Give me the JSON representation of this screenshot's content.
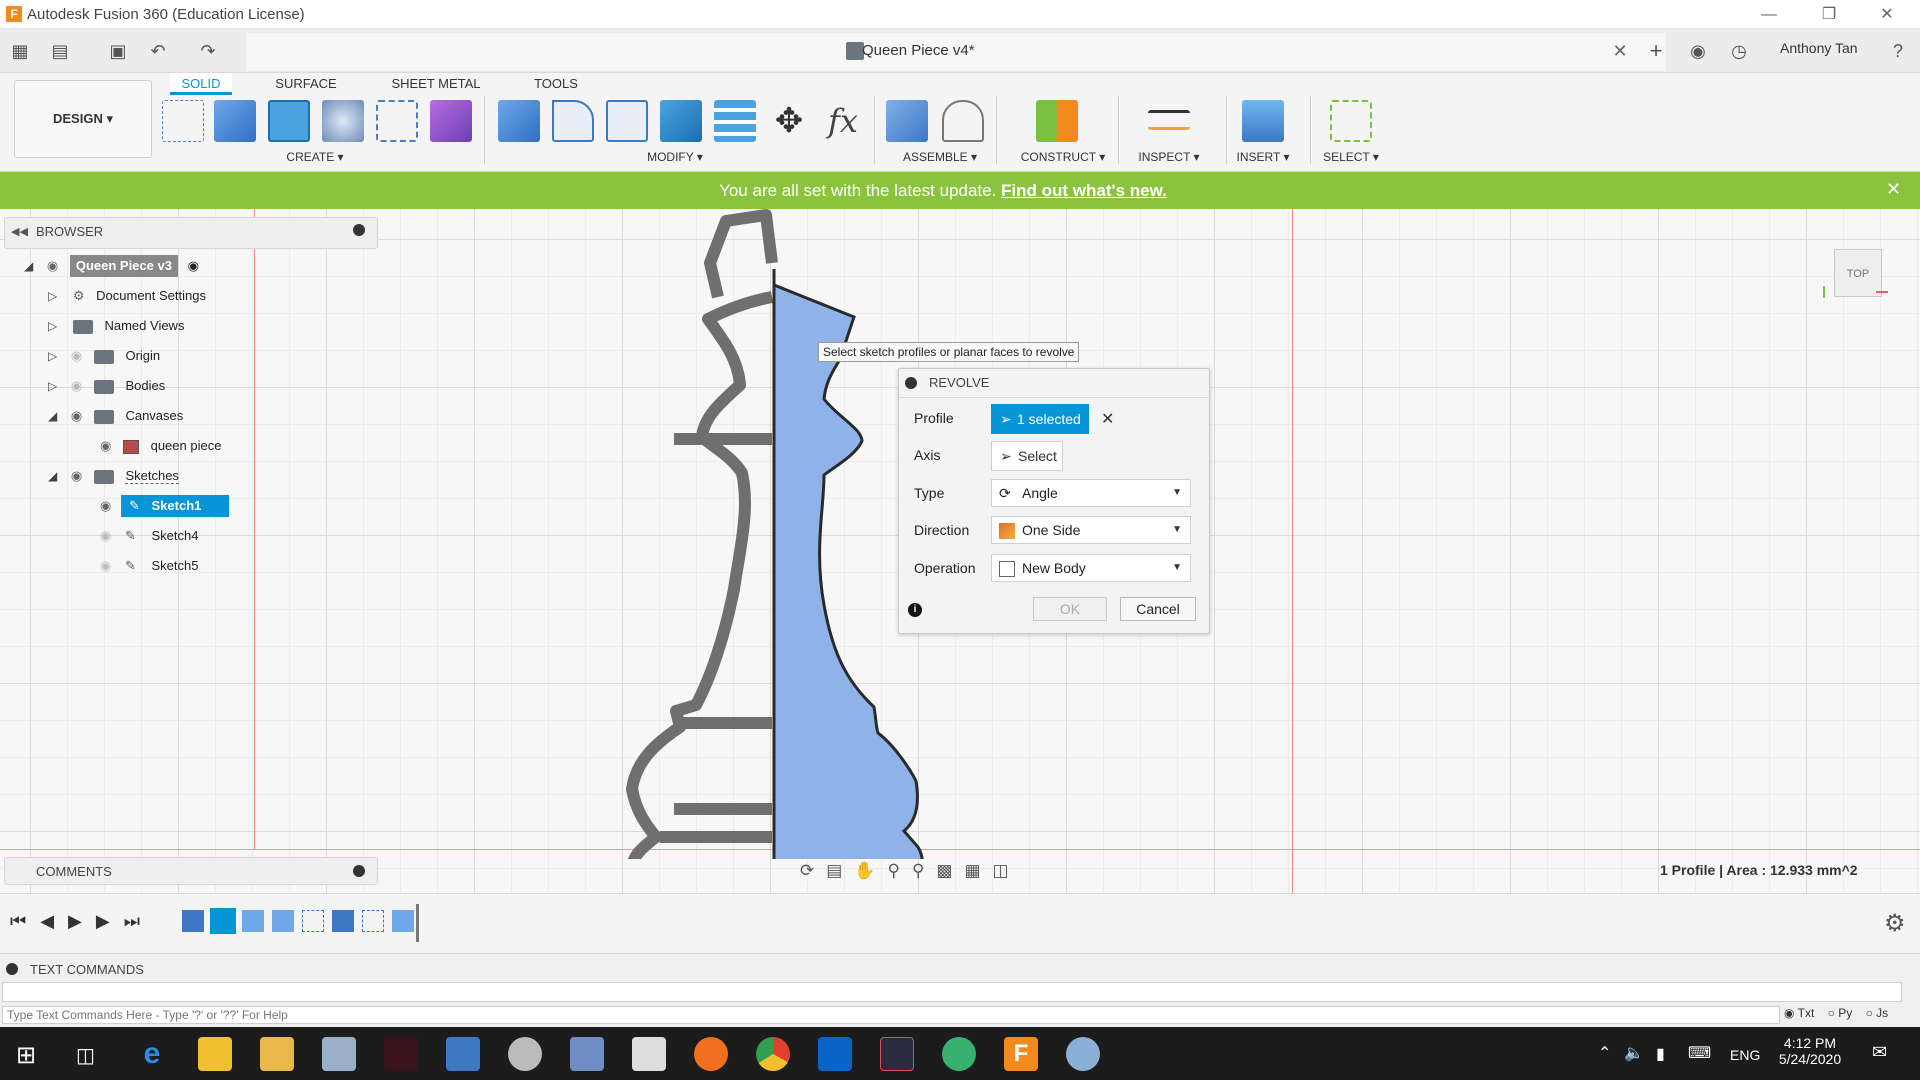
{
  "window": {
    "title": "Autodesk Fusion 360 (Education License)"
  },
  "document": {
    "title": "Queen Piece v4*",
    "user": "Anthony Tan"
  },
  "workspace": {
    "label": "DESIGN"
  },
  "ribbon": {
    "tabs": [
      "SOLID",
      "SURFACE",
      "SHEET METAL",
      "TOOLS"
    ],
    "groups": [
      "CREATE",
      "MODIFY",
      "ASSEMBLE",
      "CONSTRUCT",
      "INSPECT",
      "INSERT",
      "SELECT"
    ]
  },
  "banner": {
    "message": "You are all set with the latest update.",
    "link": "Find out what's new."
  },
  "browser": {
    "title": "BROWSER",
    "root": "Queen Piece v3",
    "items": [
      "Document Settings",
      "Named Views",
      "Origin",
      "Bodies",
      "Canvases",
      "queen piece",
      "Sketches",
      "Sketch1",
      "Sketch4",
      "Sketch5"
    ]
  },
  "tooltip": "Select sketch profiles or planar faces to revolve",
  "revolve": {
    "title": "REVOLVE",
    "profile_label": "Profile",
    "profile_value": "1 selected",
    "axis_label": "Axis",
    "axis_value": "Select",
    "type_label": "Type",
    "type_value": "Angle",
    "direction_label": "Direction",
    "direction_value": "One Side",
    "operation_label": "Operation",
    "operation_value": "New Body",
    "ok": "OK",
    "cancel": "Cancel"
  },
  "viewcube": {
    "label": "TOP"
  },
  "status": {
    "text": "1 Profile | Area : 12.933 mm^2"
  },
  "comments": {
    "title": "COMMENTS"
  },
  "textcommands": {
    "title": "TEXT COMMANDS",
    "placeholder": "Type Text Commands Here - Type '?' or '??' For Help",
    "opts": [
      "Txt",
      "Py",
      "Js"
    ]
  },
  "taskbar": {
    "time": "4:12 PM",
    "date": "5/24/2020",
    "lang": "ENG"
  },
  "colors": {
    "accent": "#0696d7",
    "banner": "#8ac43f",
    "profile": "#8fb3e8"
  }
}
